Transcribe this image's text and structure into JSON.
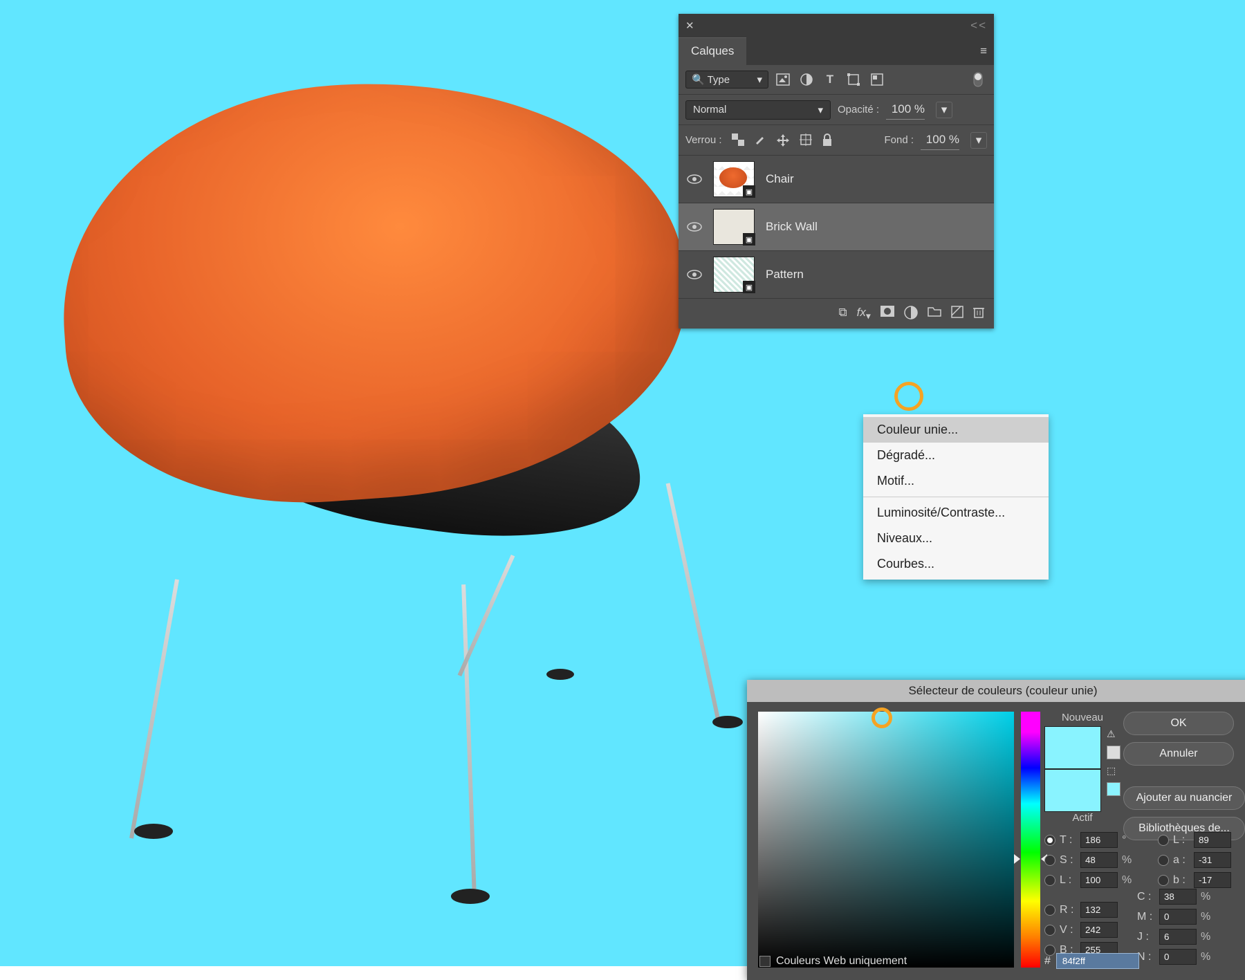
{
  "layers_panel": {
    "title": "Calques",
    "filter": {
      "type_label": "Type"
    },
    "blend": {
      "mode": "Normal",
      "opacity_label": "Opacité :",
      "opacity_value": "100 %"
    },
    "lock": {
      "label": "Verrou :",
      "fill_label": "Fond :",
      "fill_value": "100 %"
    },
    "layers": [
      {
        "name": "Chair"
      },
      {
        "name": "Brick Wall"
      },
      {
        "name": "Pattern"
      }
    ]
  },
  "context_menu": {
    "items": [
      "Couleur unie...",
      "Dégradé...",
      "Motif...",
      "Luminosité/Contraste...",
      "Niveaux...",
      "Courbes..."
    ]
  },
  "color_picker": {
    "title": "Sélecteur de couleurs (couleur unie)",
    "ok": "OK",
    "cancel": "Annuler",
    "add_swatch": "Ajouter au nuancier",
    "libraries": "Bibliothèques de...",
    "new_label": "Nouveau",
    "current_label": "Actif",
    "web_only": "Couleurs Web uniquement",
    "hex": "84f2ff",
    "hsl": {
      "t": "186",
      "s": "48",
      "l": "100"
    },
    "lab": {
      "l": "89",
      "a": "-31",
      "b": "-17"
    },
    "rgb": {
      "r": "132",
      "v": "242",
      "b": "255"
    },
    "cmyk": {
      "c": "38",
      "m": "0",
      "j": "6",
      "n": "0"
    }
  }
}
